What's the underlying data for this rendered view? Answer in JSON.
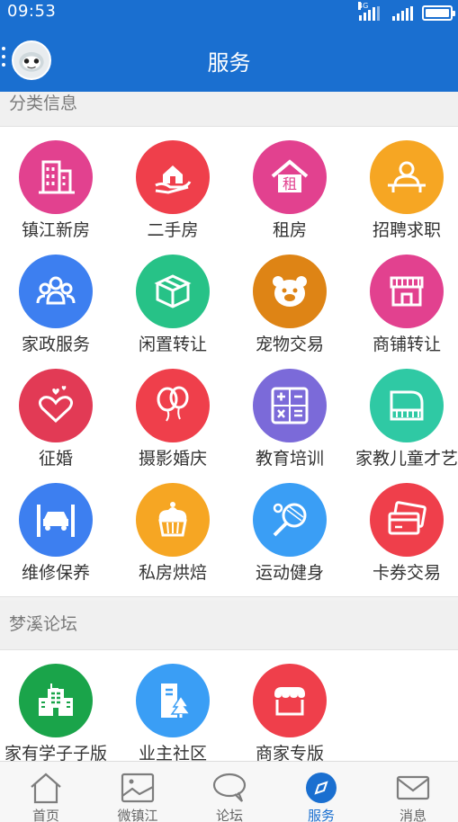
{
  "status": {
    "time": "09:53",
    "network": "4G"
  },
  "header": {
    "title": "服务"
  },
  "sections": [
    {
      "title": "分类信息"
    },
    {
      "title": "梦溪论坛"
    }
  ],
  "services": [
    {
      "label": "镇江新房",
      "icon": "building-icon",
      "color": "#e2418f"
    },
    {
      "label": "二手房",
      "icon": "hand-house-icon",
      "color": "#ef3f4b"
    },
    {
      "label": "租房",
      "icon": "rent-house-icon",
      "color": "#e2418f"
    },
    {
      "label": "招聘求职",
      "icon": "person-desk-icon",
      "color": "#f6a623"
    },
    {
      "label": "家政服务",
      "icon": "people-group-icon",
      "color": "#3d7ff0"
    },
    {
      "label": "闲置转让",
      "icon": "box-icon",
      "color": "#27c287"
    },
    {
      "label": "宠物交易",
      "icon": "bear-face-icon",
      "color": "#de8415"
    },
    {
      "label": "商铺转让",
      "icon": "shop-icon",
      "color": "#e2418f"
    },
    {
      "label": "征婚",
      "icon": "hearts-icon",
      "color": "#e23a55"
    },
    {
      "label": "摄影婚庆",
      "icon": "balloons-icon",
      "color": "#ef3f4b"
    },
    {
      "label": "教育培训",
      "icon": "calculator-icon",
      "color": "#7b6ad9"
    },
    {
      "label": "家教儿童才艺",
      "icon": "piano-icon",
      "color": "#2fc9a4"
    },
    {
      "label": "维修保养",
      "icon": "car-lift-icon",
      "color": "#3d7ff0"
    },
    {
      "label": "私房烘焙",
      "icon": "cupcake-icon",
      "color": "#f6a623"
    },
    {
      "label": "运动健身",
      "icon": "racket-icon",
      "color": "#3a9ef5"
    },
    {
      "label": "卡券交易",
      "icon": "cards-icon",
      "color": "#ef3f4b"
    }
  ],
  "forum": [
    {
      "label": "家有学子子版",
      "icon": "school-icon",
      "color": "#1aa44a"
    },
    {
      "label": "业主社区",
      "icon": "community-icon",
      "color": "#3a9ef5"
    },
    {
      "label": "商家专版",
      "icon": "storefront-icon",
      "color": "#ef3f4b"
    }
  ],
  "tabs": [
    {
      "label": "首页",
      "icon": "home-icon",
      "active": false
    },
    {
      "label": "微镇江",
      "icon": "picture-icon",
      "active": false
    },
    {
      "label": "论坛",
      "icon": "chat-bubble-icon",
      "active": false
    },
    {
      "label": "服务",
      "icon": "compass-icon",
      "active": true
    },
    {
      "label": "消息",
      "icon": "mail-icon",
      "active": false
    }
  ],
  "colors": {
    "primary": "#1a6fd0"
  }
}
